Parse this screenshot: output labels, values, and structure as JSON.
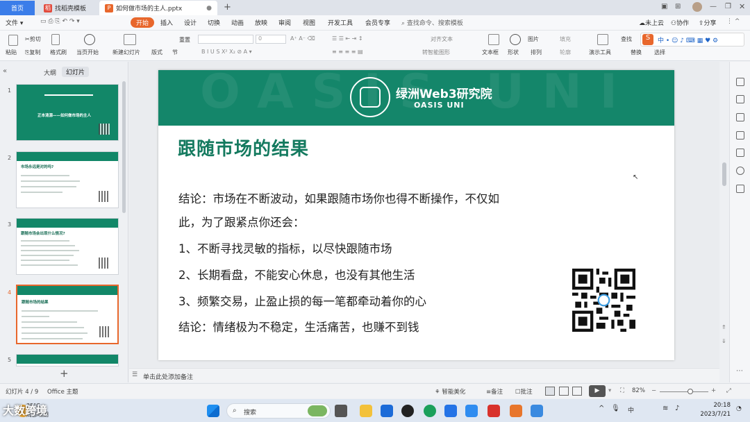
{
  "titlebar": {
    "tabs": [
      "首页",
      "找稻壳模板",
      "如何做市场的主人.pptx"
    ]
  },
  "menubar": {
    "file": "文件",
    "items": [
      "开始",
      "插入",
      "设计",
      "切换",
      "动画",
      "放映",
      "审阅",
      "视图",
      "开发工具",
      "会员专享"
    ],
    "search": "查找命令、搜索模板",
    "right": [
      "未上云",
      "协作",
      "分享"
    ]
  },
  "ribbon": {
    "paste": "粘贴",
    "cut": "剪切",
    "copy": "复制",
    "format_painter": "格式刷",
    "play_from_start": "当页开始",
    "new_slide": "新建幻灯片",
    "layout": "版式",
    "section": "节",
    "reset": "重置",
    "font_size": "0",
    "text_box": "文本框",
    "shapes": "形状",
    "arrange": "排列",
    "picture": "图片",
    "fill": "填充",
    "outline": "轮廓",
    "present_tools": "演示工具",
    "find": "查找",
    "replace": "替换",
    "select": "选择",
    "align_text": "对齐文本",
    "smart_graphic": "转智能图形"
  },
  "leftpane": {
    "tab_outline": "大纲",
    "tab_slides": "幻灯片",
    "slides": [
      {
        "num": "1",
        "title": "正本清源——如何做市场的主人"
      },
      {
        "num": "2",
        "title": "市场永远是对的吗?"
      },
      {
        "num": "3",
        "title": "跟随市场会出现什么情况?"
      },
      {
        "num": "4",
        "title": "跟随市场的结果"
      },
      {
        "num": "5",
        "title": ""
      }
    ],
    "add": "+"
  },
  "slide": {
    "org_name": "绿洲Web3研究院",
    "org_sub": "OASIS UNI",
    "band_text": "OASIS UNI",
    "title": "跟随市场的结果",
    "lines": [
      "结论：市场在不断波动，如果跟随市场你也得不断操作，不仅如",
      "此，为了跟紧点你还会：",
      "1、不断寻找灵敏的指标，以尽快跟随市场",
      "2、长期看盘，不能安心休息，也没有其他生活",
      "3、频繁交易，止盈止损的每一笔都牵动着你的心",
      "结论：情绪极为不稳定，生活痛苦，也赚不到钱"
    ]
  },
  "notes": {
    "placeholder": "单击此处添加备注"
  },
  "status": {
    "slide_pos": "幻灯片 4 / 9",
    "theme": "Office 主题",
    "beautify": "智能美化",
    "notes": "备注",
    "comments": "批注",
    "zoom": "82%"
  },
  "taskbar": {
    "search": "搜索",
    "time": "20:18",
    "date": "2023/7/21",
    "weather": "35°C",
    "weather_desc": "局部晴朗"
  },
  "watermark": "大数跨境"
}
